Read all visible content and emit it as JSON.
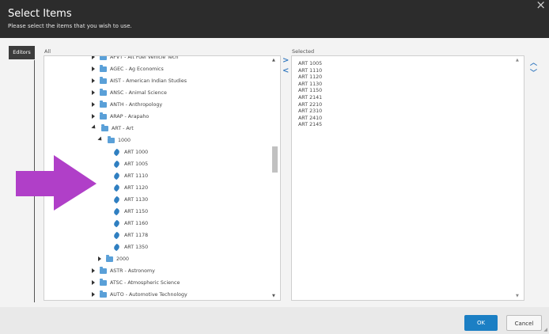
{
  "header": {
    "title": "Select Items",
    "subtitle": "Please select the items that you wish to use.",
    "close_glyph": "×"
  },
  "sidebar": {
    "tab_label": "Editors"
  },
  "tree": {
    "label": "All",
    "items": [
      {
        "label": "AFVT - Alt Fuel Vehicle Tech",
        "level": 0,
        "type": "folder",
        "state": "closed"
      },
      {
        "label": "AGEC - Ag Economics",
        "level": 0,
        "type": "folder",
        "state": "closed"
      },
      {
        "label": "AIST - American Indian Studies",
        "level": 0,
        "type": "folder",
        "state": "closed"
      },
      {
        "label": "ANSC - Animal Science",
        "level": 0,
        "type": "folder",
        "state": "closed"
      },
      {
        "label": "ANTH - Anthropology",
        "level": 0,
        "type": "folder",
        "state": "closed"
      },
      {
        "label": "ARAP - Arapaho",
        "level": 0,
        "type": "folder",
        "state": "closed"
      },
      {
        "label": "ART - Art",
        "level": 0,
        "type": "folder",
        "state": "open"
      },
      {
        "label": "1000",
        "level": 1,
        "type": "folder",
        "state": "open"
      },
      {
        "label": "ART 1000",
        "level": 2,
        "type": "leaf"
      },
      {
        "label": "ART 1005",
        "level": 2,
        "type": "leaf"
      },
      {
        "label": "ART 1110",
        "level": 2,
        "type": "leaf"
      },
      {
        "label": "ART 1120",
        "level": 2,
        "type": "leaf"
      },
      {
        "label": "ART 1130",
        "level": 2,
        "type": "leaf"
      },
      {
        "label": "ART 1150",
        "level": 2,
        "type": "leaf"
      },
      {
        "label": "ART 1160",
        "level": 2,
        "type": "leaf"
      },
      {
        "label": "ART 1178",
        "level": 2,
        "type": "leaf"
      },
      {
        "label": "ART 1350",
        "level": 2,
        "type": "leaf"
      },
      {
        "label": "2000",
        "level": 1,
        "type": "folder",
        "state": "closed"
      },
      {
        "label": "ASTR - Astronomy",
        "level": 0,
        "type": "folder",
        "state": "closed"
      },
      {
        "label": "ATSC - Atmospheric Science",
        "level": 0,
        "type": "folder",
        "state": "closed"
      },
      {
        "label": "AUTO - Automotive Technology",
        "level": 0,
        "type": "folder",
        "state": "closed"
      }
    ],
    "scroll_up_glyph": "▲",
    "scroll_down_glyph": "▼"
  },
  "transfer": {
    "add_glyph": ">",
    "remove_glyph": "<"
  },
  "selected": {
    "label": "Selected",
    "items": [
      "ART 1005",
      "ART 1110",
      "ART 1120",
      "ART 1130",
      "ART 1150",
      "ART 2141",
      "ART 2210",
      "ART 2310",
      "ART 2410",
      "ART 2145"
    ],
    "scroll_up_glyph": "▲",
    "scroll_down_glyph": "▼"
  },
  "reorder": {
    "up_glyph": "︿",
    "down_glyph": "﹀"
  },
  "footer": {
    "ok_label": "OK",
    "cancel_label": "Cancel",
    "grip_glyph": "◢"
  },
  "colors": {
    "header_bg": "#2c2c2c",
    "accent": "#1b7fc4",
    "arrow_overlay": "#b03fc8",
    "folder": "#5aa0d8"
  }
}
